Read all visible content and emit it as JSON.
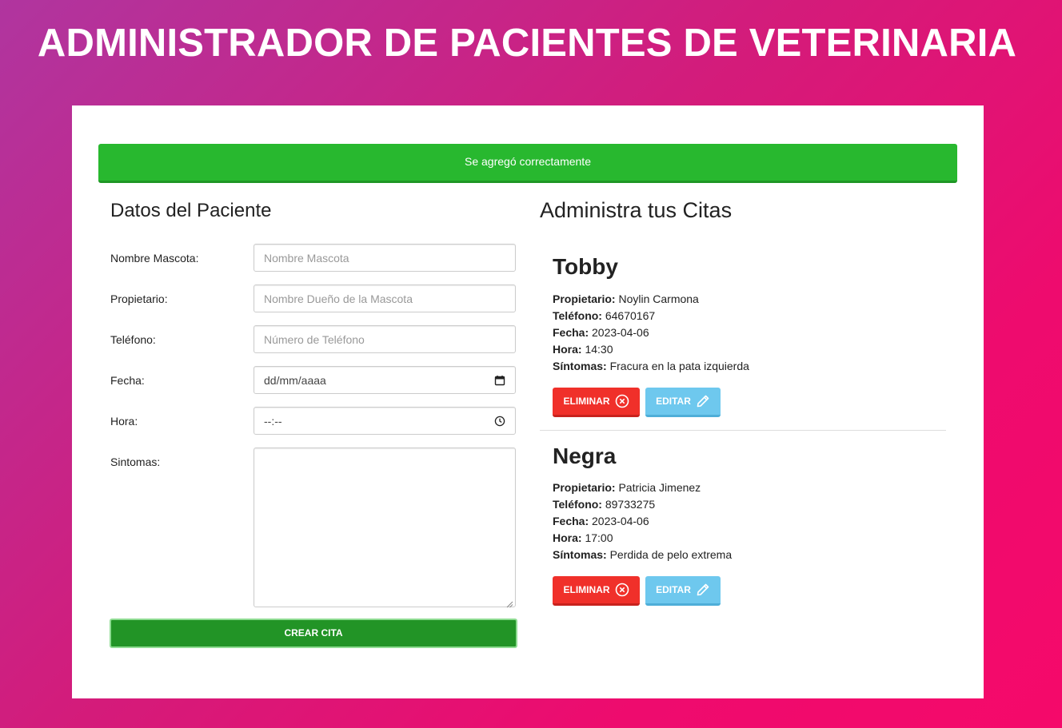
{
  "header": {
    "title": "ADMINISTRADOR DE PACIENTES DE VETERINARIA"
  },
  "alert": {
    "message": "Se agregó correctamente"
  },
  "form": {
    "title": "Datos del Paciente",
    "fields": [
      {
        "label": "Nombre Mascota:",
        "placeholder": "Nombre Mascota"
      },
      {
        "label": "Propietario:",
        "placeholder": "Nombre Dueño de la Mascota"
      },
      {
        "label": "Teléfono:",
        "placeholder": "Número de Teléfono"
      },
      {
        "label": "Fecha:",
        "placeholder": "dd/mm/aaaa"
      },
      {
        "label": "Hora:",
        "placeholder": "--:--"
      },
      {
        "label": "Sintomas:",
        "placeholder": ""
      }
    ],
    "submit_label": "CREAR CITA"
  },
  "citas": {
    "title": "Administra tus Citas",
    "labels": {
      "owner": "Propietario:",
      "phone": "Teléfono:",
      "date": "Fecha:",
      "time": "Hora:",
      "symptoms": "Síntomas:"
    },
    "items": [
      {
        "name": "Tobby",
        "owner": "Noylin Carmona",
        "phone": "64670167",
        "date": "2023-04-06",
        "time": "14:30",
        "symptoms": "Fracura en la pata izquierda",
        "delete_label": "ELIMINAR",
        "edit_label": "EDITAR"
      },
      {
        "name": "Negra",
        "owner": "Patricia Jimenez",
        "phone": "89733275",
        "date": "2023-04-06",
        "time": "17:00",
        "symptoms": "Perdida de pelo extrema",
        "delete_label": "ELIMINAR",
        "edit_label": "EDITAR"
      }
    ]
  },
  "colors": {
    "success": "#28b82f",
    "submit": "#229426",
    "danger": "#f0302a",
    "info": "#6ec8ee"
  }
}
